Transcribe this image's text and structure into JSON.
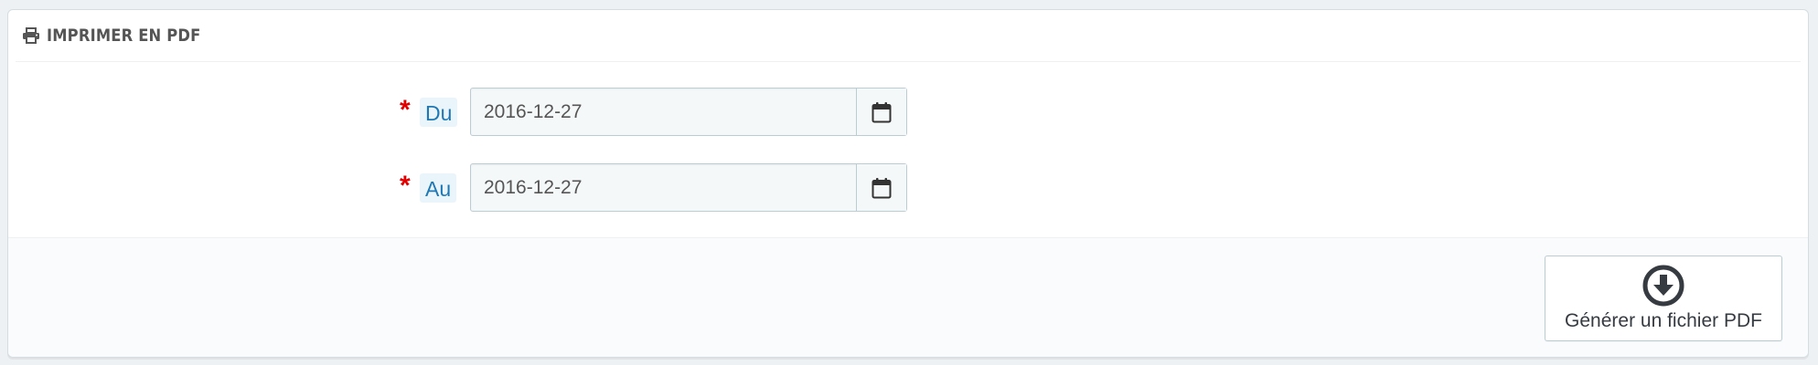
{
  "panel": {
    "title": "IMPRIMER EN PDF",
    "title_icon": "print-icon"
  },
  "form": {
    "from": {
      "required_marker": "*",
      "label": "Du",
      "value": "2016-12-27",
      "icon": "calendar-icon"
    },
    "to": {
      "required_marker": "*",
      "label": "Au",
      "value": "2016-12-27",
      "icon": "calendar-icon"
    }
  },
  "footer": {
    "generate_button_label": "Générer un fichier PDF",
    "generate_button_icon": "download-circle-icon"
  },
  "colors": {
    "label_text": "#1f78b4",
    "label_bg": "#eaf5fb",
    "required": "#e00000",
    "border": "#bbcdd2"
  }
}
